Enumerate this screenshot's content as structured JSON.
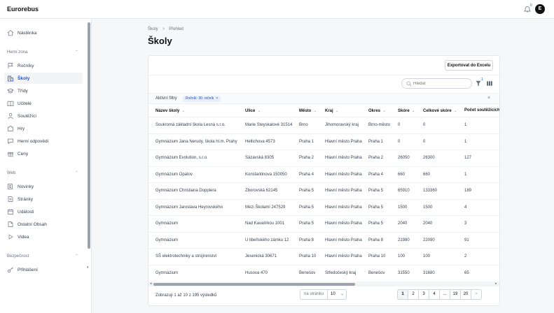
{
  "app": {
    "title": "Eurorebus",
    "notification_count": "0",
    "avatar_initial": "E"
  },
  "sidebar": {
    "top_items": [
      {
        "label": "Nástěnka",
        "icon": "home-icon"
      }
    ],
    "sections": [
      {
        "title": "Herní zona",
        "items": [
          {
            "label": "Ročníky",
            "icon": "flag-icon"
          },
          {
            "label": "Školy",
            "icon": "building-icon",
            "active": true
          },
          {
            "label": "Třídy",
            "icon": "graduation-cap-icon"
          },
          {
            "label": "Učitelé",
            "icon": "book-icon"
          },
          {
            "label": "Soutěžící",
            "icon": "user-icon"
          },
          {
            "label": "Hry",
            "icon": "puzzle-icon"
          },
          {
            "label": "Herní odpovědi",
            "icon": "chat-icon"
          },
          {
            "label": "Ceny",
            "icon": "gift-icon"
          }
        ]
      },
      {
        "title": "Web",
        "items": [
          {
            "label": "Novinky",
            "icon": "newspaper-icon"
          },
          {
            "label": "Stránky",
            "icon": "pages-icon"
          },
          {
            "label": "Události",
            "icon": "calendar-icon"
          },
          {
            "label": "Ostatní Obsah",
            "icon": "document-icon"
          },
          {
            "label": "Videa",
            "icon": "play-icon"
          }
        ]
      },
      {
        "title": "Bezpečnost",
        "items": [
          {
            "label": "Přihlášení",
            "icon": "key-icon"
          }
        ]
      }
    ]
  },
  "breadcrumb": {
    "parent": "Školy",
    "separator": ">",
    "current": "Přehled"
  },
  "page_title": "Školy",
  "toolbar": {
    "export_label": "Exportovat do Excelu",
    "search_placeholder": "Hledat",
    "filter_count": "1"
  },
  "filters": {
    "label": "Aktivní filtry",
    "chips": [
      "Ročník: 30. ročník"
    ],
    "close": "×"
  },
  "table": {
    "columns": [
      "Název školy",
      "Ulice",
      "Město",
      "Kraj",
      "Okres",
      "Skóre",
      "Celkové skóre",
      "Počet soutěžících"
    ],
    "rows": [
      [
        "Soukromá základní škola Lesná s.r.o.",
        "Marie Steyskalové 31514",
        "Brno",
        "Jihomoravský kraj",
        "Brno-město",
        "0",
        "0",
        "1"
      ],
      [
        "Gymnázium Jana Nerudy, škola hl.m. Prahy",
        "Hellichova 4573",
        "Praha 1",
        "Hlavní město Praha",
        "Praha 1",
        "0",
        "0",
        "1"
      ],
      [
        "Gymnázium Evolution, s.r.o.",
        "Sázavská 8305",
        "Praha 2",
        "Hlavní město Praha",
        "Praha 2",
        "26050",
        "26300",
        "127"
      ],
      [
        "Gymnázium Opatov",
        "Konstantinova 150050",
        "Praha 4",
        "Hlavní město Praha",
        "Praha 4",
        "660",
        "660",
        "1"
      ],
      [
        "Gymnázium Christiana Dopplera",
        "Zborovská 62145",
        "Praha 5",
        "Hlavní město Praha",
        "Praha 5",
        "65910",
        "133360",
        "189"
      ],
      [
        "Gymnázium Jaroslava Heyrovského",
        "Mezi Školami 247529",
        "Praha 5",
        "Hlavní město Praha",
        "Praha 5",
        "1500",
        "1500",
        "4"
      ],
      [
        "Gymnázium",
        "Nad Kavalírkou 1001",
        "Praha 5",
        "Hlavní město Praha",
        "Praha 5",
        "2040",
        "2040",
        "3"
      ],
      [
        "Gymnázium",
        "U libeňského zámku 12",
        "Praha 8",
        "Hlavní město Praha",
        "Praha 8",
        "21980",
        "22090",
        "91"
      ],
      [
        "SŠ elektrotechniky a strojírenství",
        "Jesenická 30671",
        "Praha 10",
        "Hlavní město Praha",
        "Praha 10",
        "100",
        "100",
        "2"
      ],
      [
        "Gymnázium",
        "Husova 470",
        "Benešov",
        "Středočeský kraj",
        "Benešov",
        "31550",
        "31680",
        "65"
      ]
    ]
  },
  "footer": {
    "summary": "Zobrazuji 1 až 10 z 195 výsledků",
    "per_page_label": "na stránku",
    "per_page_value": "10",
    "pages": [
      "1",
      "2",
      "3",
      "4",
      "...",
      "19",
      "20"
    ],
    "next": ">"
  }
}
